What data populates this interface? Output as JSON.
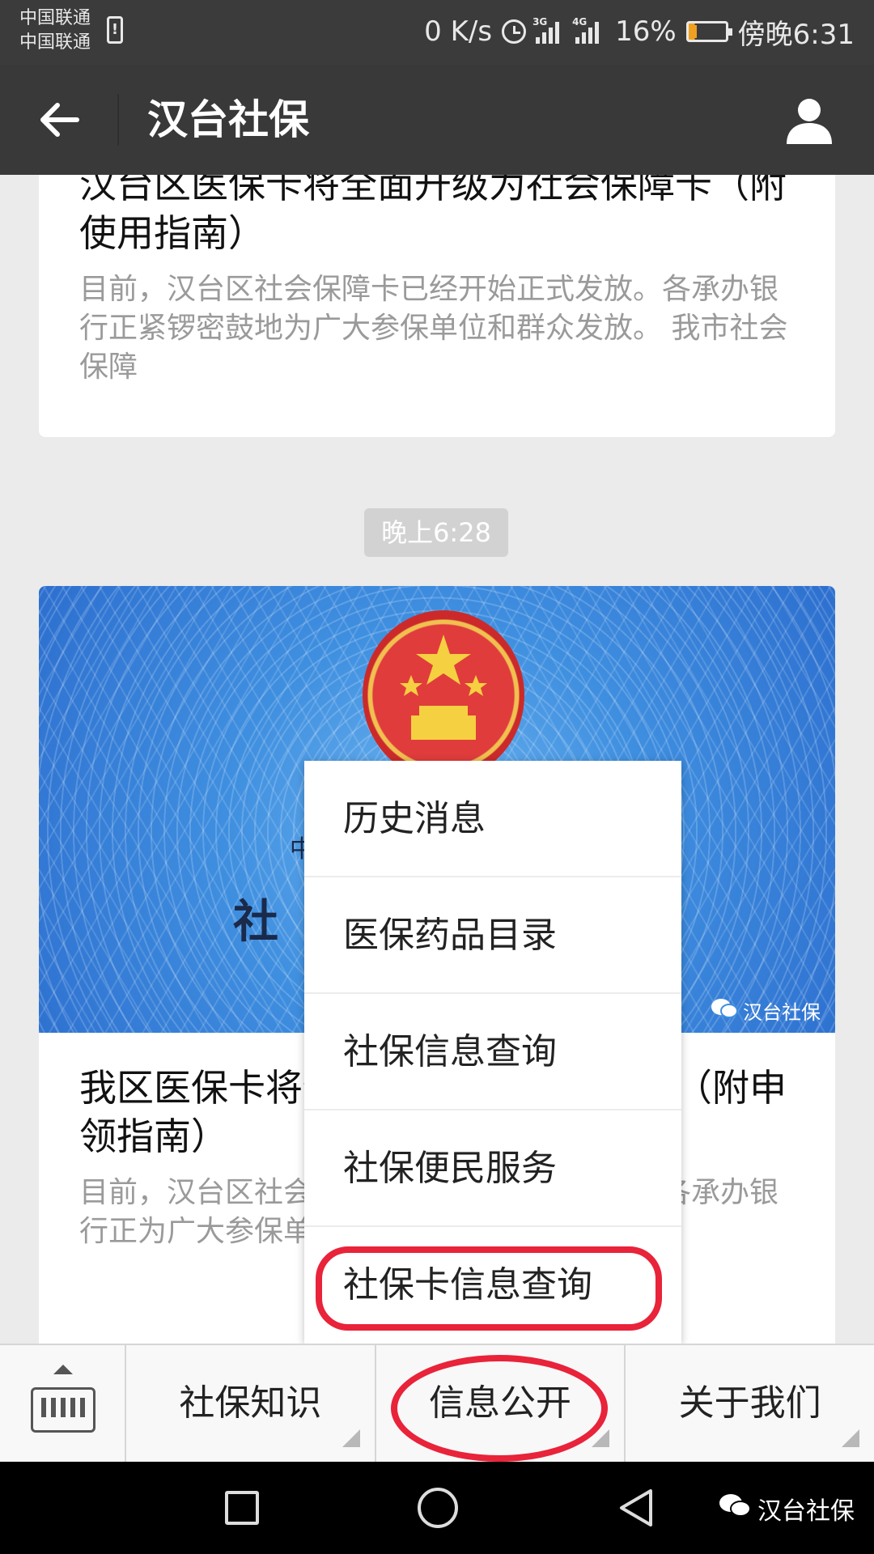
{
  "status_bar": {
    "carrier_1": "中国联通",
    "carrier_2": "中国联通",
    "net_speed": "0 K/s",
    "signal_1_tag": "3G",
    "signal_2_tag": "4G",
    "battery_percent": "16%",
    "time": "傍晚6:31",
    "battery_level": 0.16
  },
  "title_bar": {
    "title": "汉台社保"
  },
  "feed": {
    "card_1": {
      "title": "汉台区医保卡将全面升级为社会保障卡（附使用指南）",
      "desc": "目前，汉台区社会保障卡已经开始正式发放。各承办银行正紧锣密鼓地为广大参保单位和群众发放。  我市社会保障"
    },
    "timestamp": "晚上6:28",
    "card_2": {
      "cover_text": "社",
      "cover_small": "中",
      "cover_watermark": "汉台社保",
      "title": "我区医保卡将全面升级为社会保障卡（附申领指南）",
      "desc": "目前，汉台区社会保障卡已经开始正式发放。各承办银行正为广大参保单位和群众发放。"
    }
  },
  "popup_menu": {
    "items": [
      {
        "label": "历史消息"
      },
      {
        "label": "医保药品目录"
      },
      {
        "label": "社保信息查询"
      },
      {
        "label": "社保便民服务"
      },
      {
        "label": "社保卡信息查询"
      }
    ]
  },
  "menu_bar": {
    "tabs": [
      {
        "label": "社保知识"
      },
      {
        "label": "信息公开"
      },
      {
        "label": "关于我们"
      }
    ]
  },
  "nav_bar": {
    "watermark": "汉台社保"
  },
  "colors": {
    "highlight": "#e8233a",
    "title_bar": "#393939",
    "feed_background": "#ebebeb"
  }
}
